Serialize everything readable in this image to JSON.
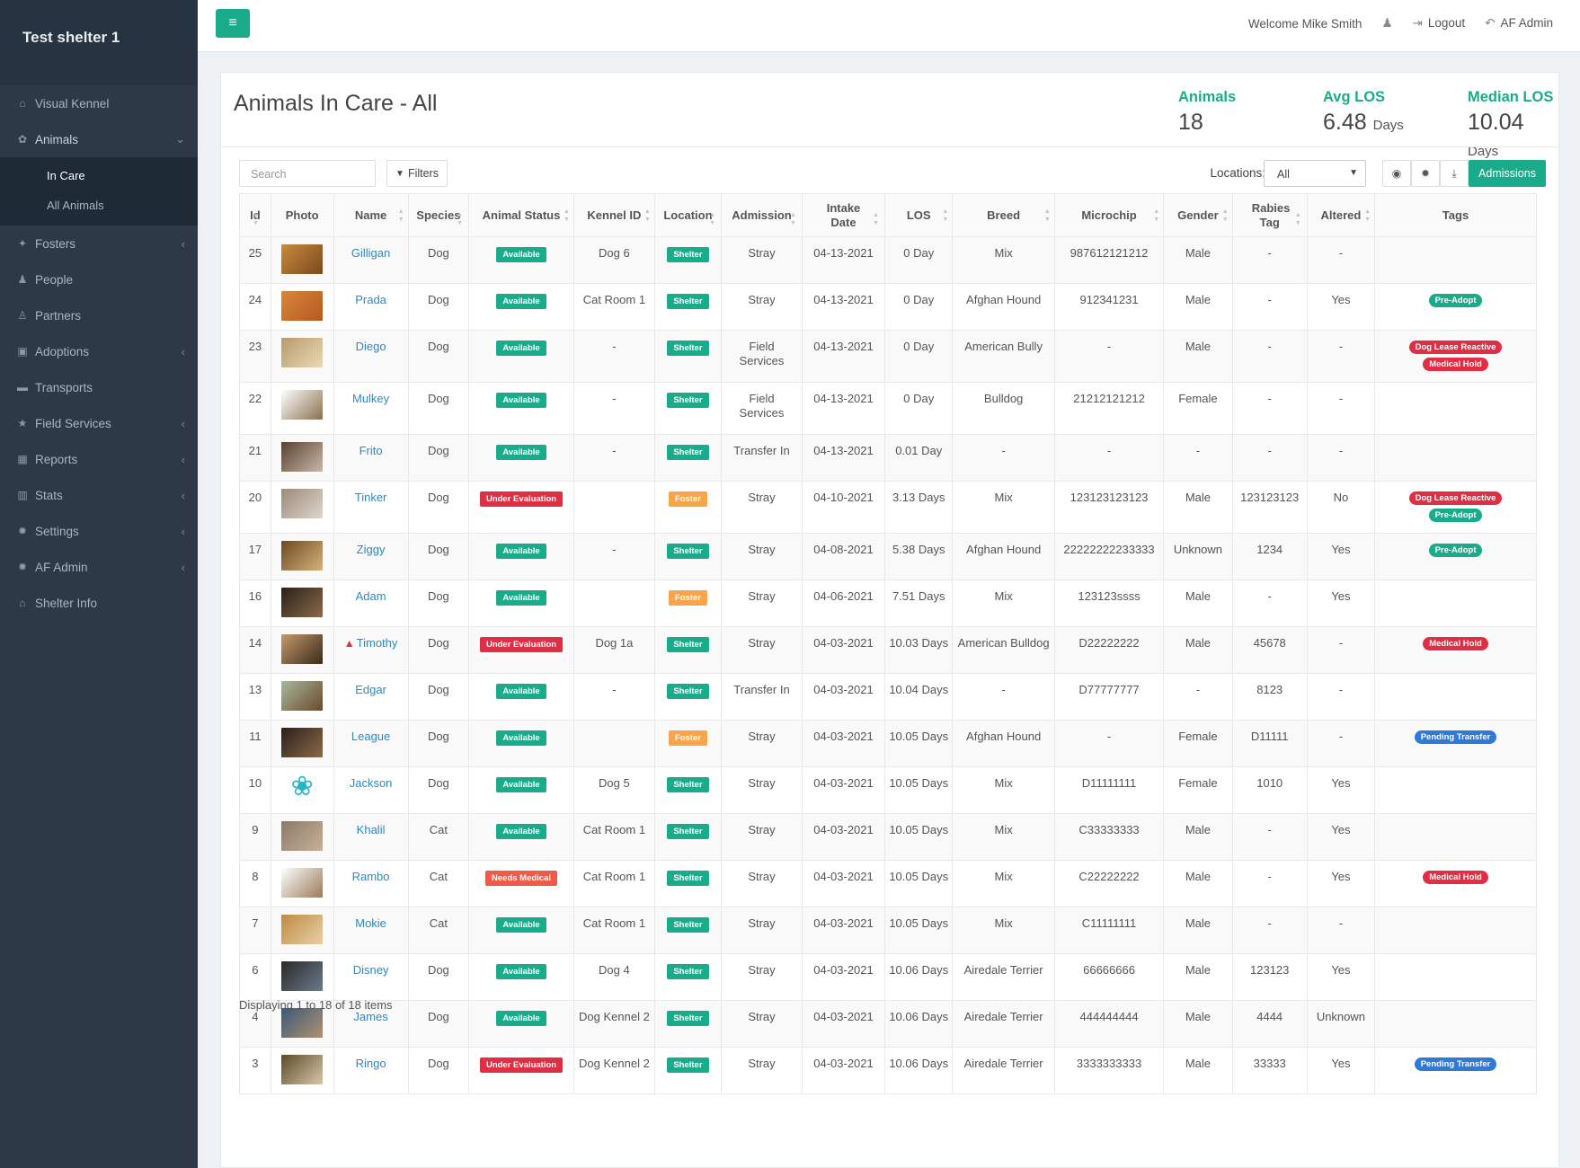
{
  "sidebar": {
    "brand": "Test shelter 1",
    "items": [
      {
        "label": "Visual Kennel",
        "icon": "home-icon",
        "glyph": "⌂",
        "chevron": false
      },
      {
        "label": "Animals",
        "icon": "paw-icon",
        "glyph": "✿",
        "chevron": true,
        "open": true
      },
      {
        "label": "Fosters",
        "icon": "child-icon",
        "glyph": "✦",
        "chevron": true
      },
      {
        "label": "People",
        "icon": "users-icon",
        "glyph": "♟",
        "chevron": false
      },
      {
        "label": "Partners",
        "icon": "user-icon",
        "glyph": "♙",
        "chevron": false
      },
      {
        "label": "Adoptions",
        "icon": "gift-icon",
        "glyph": "▣",
        "chevron": true
      },
      {
        "label": "Transports",
        "icon": "truck-icon",
        "glyph": "▬",
        "chevron": false
      },
      {
        "label": "Field Services",
        "icon": "star-icon",
        "glyph": "★",
        "chevron": true
      },
      {
        "label": "Reports",
        "icon": "table-icon",
        "glyph": "▦",
        "chevron": true
      },
      {
        "label": "Stats",
        "icon": "chart-icon",
        "glyph": "▥",
        "chevron": true
      },
      {
        "label": "Settings",
        "icon": "gear-icon",
        "glyph": "✹",
        "chevron": true
      },
      {
        "label": "AF Admin",
        "icon": "gear-icon",
        "glyph": "✹",
        "chevron": true
      },
      {
        "label": "Shelter Info",
        "icon": "home-icon",
        "glyph": "⌂",
        "chevron": false
      }
    ],
    "animals_sub": [
      "In Care",
      "All Animals"
    ]
  },
  "topbar": {
    "welcome": "Welcome Mike Smith",
    "logout": "Logout",
    "admin": "AF Admin"
  },
  "page": {
    "title": "Animals In Care - All",
    "stats": {
      "animals_label": "Animals",
      "animals_value": "18",
      "avg_label": "Avg LOS",
      "avg_value": "6.48",
      "avg_unit": "Days",
      "median_label": "Median LOS",
      "median_value": "10.04",
      "median_unit": "Days"
    }
  },
  "toolbar": {
    "search_placeholder": "Search",
    "filters_label": "Filters",
    "locations_label": "Locations:",
    "locations_value": "All",
    "admissions_label": "Admissions"
  },
  "table": {
    "headers": [
      "Id",
      "Photo",
      "Name",
      "Species",
      "Animal Status",
      "Kennel ID",
      "Location",
      "Admission",
      "Intake Date",
      "LOS",
      "Breed",
      "Microchip",
      "Gender",
      "Rabies Tag",
      "Altered",
      "Tags"
    ],
    "rows": [
      {
        "id": "25",
        "name": "Gilligan",
        "species": "Dog",
        "status": "Available",
        "kennel": "Dog 6",
        "location": "Shelter",
        "admission": "Stray",
        "intake": "04-13-2021",
        "los": "0 Day",
        "breed": "Mix",
        "microchip": "987612121212",
        "gender": "Male",
        "rabies": "-",
        "altered": "-",
        "tags": [],
        "photo": [
          "#c98a3e",
          "#7a4a1c"
        ]
      },
      {
        "id": "24",
        "name": "Prada",
        "species": "Dog",
        "status": "Available",
        "kennel": "Cat Room 1",
        "location": "Shelter",
        "admission": "Stray",
        "intake": "04-13-2021",
        "los": "0 Day",
        "breed": "Afghan Hound",
        "microchip": "912341231",
        "gender": "Male",
        "rabies": "-",
        "altered": "Yes",
        "tags": [
          "Pre-Adopt"
        ],
        "photo": [
          "#d9863a",
          "#b35a21"
        ]
      },
      {
        "id": "23",
        "name": "Diego",
        "species": "Dog",
        "status": "Available",
        "kennel": "-",
        "location": "Shelter",
        "admission": "Field Services",
        "intake": "04-13-2021",
        "los": "0 Day",
        "breed": "American Bully",
        "microchip": "-",
        "gender": "Male",
        "rabies": "-",
        "altered": "-",
        "tags": [
          "Dog Lease Reactive",
          "Medical Hold"
        ],
        "photo": [
          "#b89a6c",
          "#e8d9b5"
        ]
      },
      {
        "id": "22",
        "name": "Mulkey",
        "species": "Dog",
        "status": "Available",
        "kennel": "-",
        "location": "Shelter",
        "admission": "Field Services",
        "intake": "04-13-2021",
        "los": "0 Day",
        "breed": "Bulldog",
        "microchip": "21212121212",
        "gender": "Female",
        "rabies": "-",
        "altered": "-",
        "tags": [],
        "photo": [
          "#ffffff",
          "#8a7050"
        ]
      },
      {
        "id": "21",
        "name": "Frito",
        "species": "Dog",
        "status": "Available",
        "kennel": "-",
        "location": "Shelter",
        "admission": "Transfer In",
        "intake": "04-13-2021",
        "los": "0.01 Day",
        "breed": "-",
        "microchip": "-",
        "gender": "-",
        "rabies": "-",
        "altered": "-",
        "tags": [],
        "photo": [
          "#5a4030",
          "#c8b8a8"
        ]
      },
      {
        "id": "20",
        "name": "Tinker",
        "species": "Dog",
        "status": "Under Evaluation",
        "kennel": "",
        "location": "Foster",
        "admission": "Stray",
        "intake": "04-10-2021",
        "los": "3.13 Days",
        "breed": "Mix",
        "microchip": "123123123123",
        "gender": "Male",
        "rabies": "123123123",
        "altered": "No",
        "tags": [
          "Dog Lease Reactive",
          "Pre-Adopt"
        ],
        "photo": [
          "#9a8a7a",
          "#e0d6cc"
        ]
      },
      {
        "id": "17",
        "name": "Ziggy",
        "species": "Dog",
        "status": "Available",
        "kennel": "-",
        "location": "Shelter",
        "admission": "Stray",
        "intake": "04-08-2021",
        "los": "5.38 Days",
        "breed": "Afghan Hound",
        "microchip": "22222222233333",
        "gender": "Unknown",
        "rabies": "1234",
        "altered": "Yes",
        "tags": [
          "Pre-Adopt"
        ],
        "photo": [
          "#6b4a24",
          "#d6b27a"
        ]
      },
      {
        "id": "16",
        "name": "Adam",
        "species": "Dog",
        "status": "Available",
        "kennel": "",
        "location": "Foster",
        "admission": "Stray",
        "intake": "04-06-2021",
        "los": "7.51 Days",
        "breed": "Mix",
        "microchip": "123123ssss",
        "gender": "Male",
        "rabies": "-",
        "altered": "Yes",
        "tags": [],
        "photo": [
          "#2a201a",
          "#8a6a4a"
        ]
      },
      {
        "id": "14",
        "name": "Timothy",
        "warning": true,
        "species": "Dog",
        "status": "Under Evaluation",
        "kennel": "Dog 1a",
        "location": "Shelter",
        "admission": "Stray",
        "intake": "04-03-2021",
        "los": "10.03 Days",
        "breed": "American Bulldog",
        "microchip": "D22222222",
        "gender": "Male",
        "rabies": "45678",
        "altered": "-",
        "tags": [
          "Medical Hold"
        ],
        "photo": [
          "#c49a6c",
          "#3a2a1a"
        ]
      },
      {
        "id": "13",
        "name": "Edgar",
        "species": "Dog",
        "status": "Available",
        "kennel": "-",
        "location": "Shelter",
        "admission": "Transfer In",
        "intake": "04-03-2021",
        "los": "10.04 Days",
        "breed": "-",
        "microchip": "D77777777",
        "gender": "-",
        "rabies": "8123",
        "altered": "-",
        "tags": [],
        "photo": [
          "#a8b8a0",
          "#6a4a2a"
        ]
      },
      {
        "id": "11",
        "name": "League",
        "species": "Dog",
        "status": "Available",
        "kennel": "",
        "location": "Foster",
        "admission": "Stray",
        "intake": "04-03-2021",
        "los": "10.05 Days",
        "breed": "Afghan Hound",
        "microchip": "-",
        "gender": "Female",
        "rabies": "D11111",
        "altered": "-",
        "tags": [
          "Pending Transfer"
        ],
        "photo": [
          "#2a201a",
          "#8a6a4a"
        ]
      },
      {
        "id": "10",
        "name": "Jackson",
        "species": "Dog",
        "status": "Available",
        "kennel": "Dog 5",
        "location": "Shelter",
        "admission": "Stray",
        "intake": "04-03-2021",
        "los": "10.05 Days",
        "breed": "Mix",
        "microchip": "D11111111",
        "gender": "Female",
        "rabies": "1010",
        "altered": "Yes",
        "tags": [],
        "paw": true
      },
      {
        "id": "9",
        "name": "Khalil",
        "species": "Cat",
        "status": "Available",
        "kennel": "Cat Room 1",
        "location": "Shelter",
        "admission": "Stray",
        "intake": "04-03-2021",
        "los": "10.05 Days",
        "breed": "Mix",
        "microchip": "C33333333",
        "gender": "Male",
        "rabies": "-",
        "altered": "Yes",
        "tags": [],
        "photo": [
          "#8a7a6a",
          "#c8b098"
        ]
      },
      {
        "id": "8",
        "name": "Rambo",
        "species": "Cat",
        "status": "Needs Medical",
        "kennel": "Cat Room 1",
        "location": "Shelter",
        "admission": "Stray",
        "intake": "04-03-2021",
        "los": "10.05 Days",
        "breed": "Mix",
        "microchip": "C22222222",
        "gender": "Male",
        "rabies": "-",
        "altered": "Yes",
        "tags": [
          "Medical Hold"
        ],
        "photo": [
          "#ffffff",
          "#9a7a5a"
        ]
      },
      {
        "id": "7",
        "name": "Mokie",
        "species": "Cat",
        "status": "Available",
        "kennel": "Cat Room 1",
        "location": "Shelter",
        "admission": "Stray",
        "intake": "04-03-2021",
        "los": "10.05 Days",
        "breed": "Mix",
        "microchip": "C11111111",
        "gender": "Male",
        "rabies": "-",
        "altered": "-",
        "tags": [],
        "photo": [
          "#c08a40",
          "#e8d0a8"
        ]
      },
      {
        "id": "6",
        "name": "Disney",
        "species": "Dog",
        "status": "Available",
        "kennel": "Dog 4",
        "location": "Shelter",
        "admission": "Stray",
        "intake": "04-03-2021",
        "los": "10.06 Days",
        "breed": "Airedale Terrier",
        "microchip": "66666666",
        "gender": "Male",
        "rabies": "123123",
        "altered": "Yes",
        "tags": [],
        "photo": [
          "#2a2a2a",
          "#6a7a8a"
        ]
      },
      {
        "id": "4",
        "name": "James",
        "species": "Dog",
        "status": "Available",
        "kennel": "Dog Kennel 2",
        "location": "Shelter",
        "admission": "Stray",
        "intake": "04-03-2021",
        "los": "10.06 Days",
        "breed": "Airedale Terrier",
        "microchip": "444444444",
        "gender": "Male",
        "rabies": "4444",
        "altered": "Unknown",
        "tags": [],
        "photo": [
          "#3a5a7a",
          "#b09070"
        ]
      },
      {
        "id": "3",
        "name": "Ringo",
        "species": "Dog",
        "status": "Under Evaluation",
        "kennel": "Dog Kennel 2",
        "location": "Shelter",
        "admission": "Stray",
        "intake": "04-03-2021",
        "los": "10.06 Days",
        "breed": "Airedale Terrier",
        "microchip": "3333333333",
        "gender": "Male",
        "rabies": "33333",
        "altered": "Yes",
        "tags": [
          "Pending Transfer"
        ],
        "photo": [
          "#5a4a2a",
          "#d8c8a8"
        ]
      }
    ]
  },
  "footer": {
    "displaying": "Displaying 1 to 18 of 18 items"
  },
  "colors": {
    "accent": "#1aab8a",
    "danger": "#e02e44",
    "warning": "#f7a54a",
    "info": "#2f7ad8",
    "link": "#2a8bc5",
    "sidebar": "#2c3a48"
  }
}
